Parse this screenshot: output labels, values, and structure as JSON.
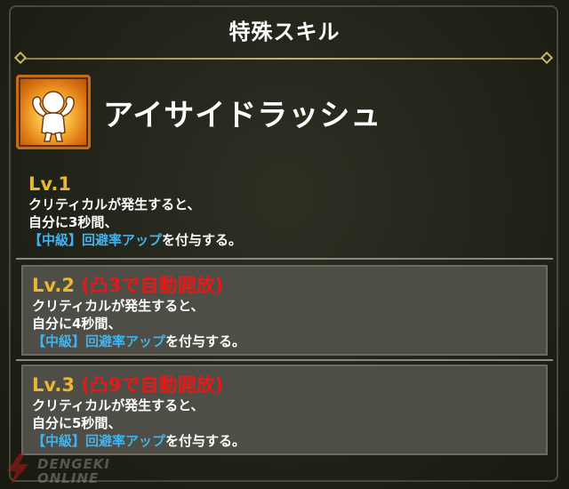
{
  "header": {
    "title": "特殊スキル"
  },
  "skill": {
    "name": "アイサイドラッシュ",
    "icon": "muscle-flex-icon"
  },
  "levels": [
    {
      "label": "Lv.1",
      "unlock": "",
      "line1": "クリティカルが発生すると、",
      "line2": "自分に3秒間、",
      "buff": "【中級】回避率アップ",
      "suffix": "を付与する。"
    },
    {
      "label": "Lv.2",
      "unlock": "(凸3で自動開放)",
      "line1": "クリティカルが発生すると、",
      "line2": "自分に4秒間、",
      "buff": "【中級】回避率アップ",
      "suffix": "を付与する。"
    },
    {
      "label": "Lv.3",
      "unlock": "(凸9で自動開放)",
      "line1": "クリティカルが発生すると、",
      "line2": "自分に5秒間、",
      "buff": "【中級】回避率アップ",
      "suffix": "を付与する。"
    }
  ],
  "watermark": {
    "line1": "DENGEKI",
    "line2": "ONLINE"
  },
  "colors": {
    "level_label": "#e8b830",
    "unlock_text": "#e11b1b",
    "buff_text": "#3fb4f0",
    "icon_border": "#c96b15"
  }
}
